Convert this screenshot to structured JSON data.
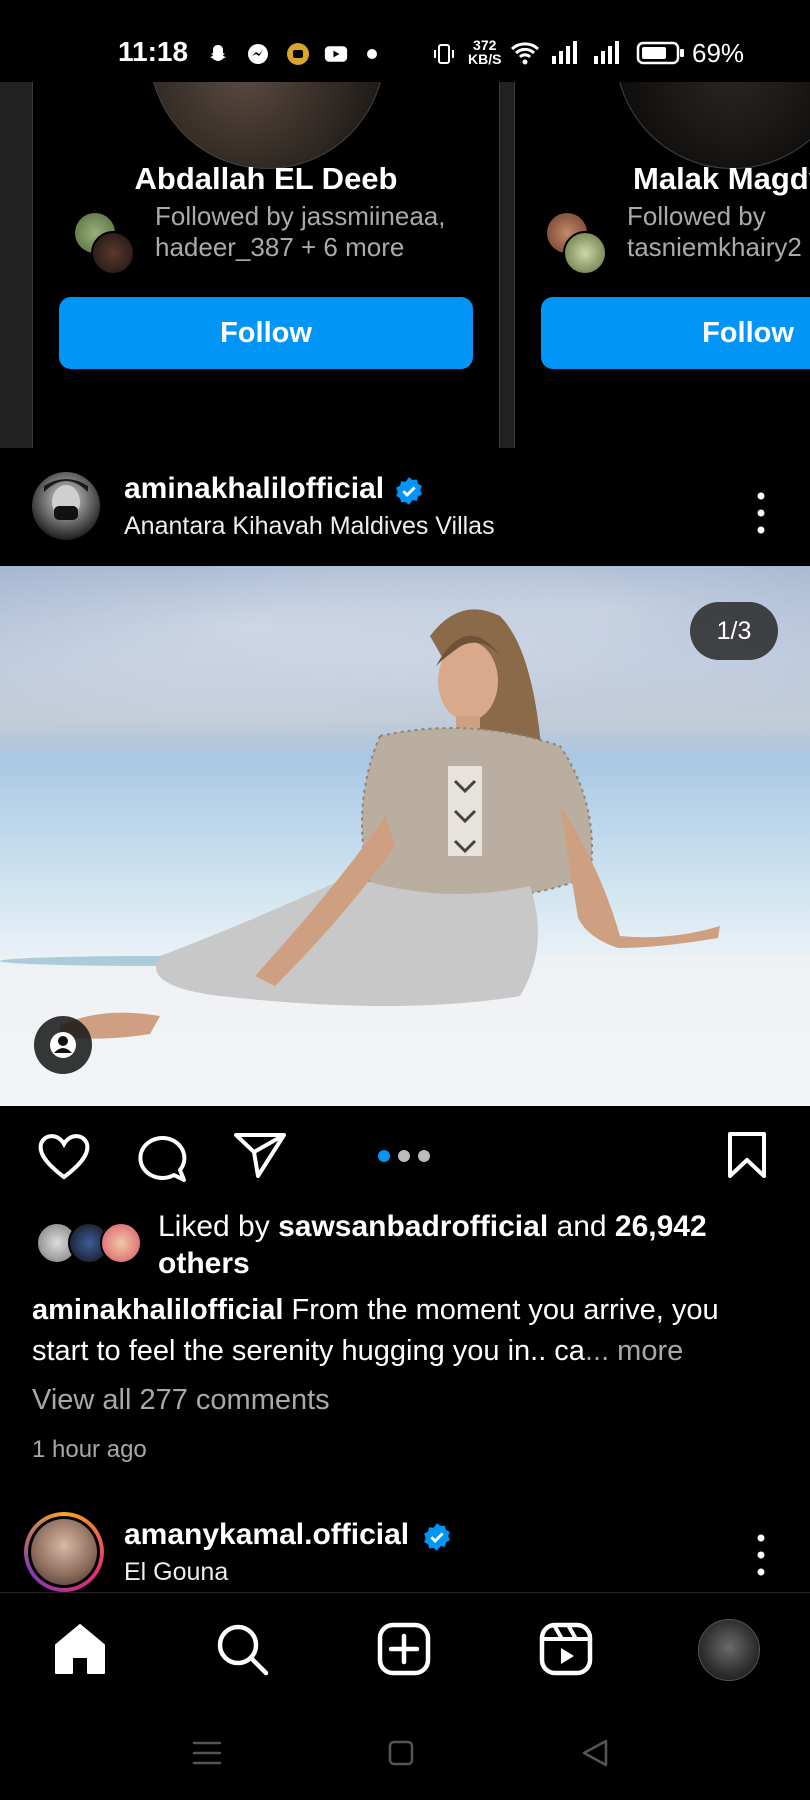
{
  "status_bar": {
    "time": "11:18",
    "net_speed_value": "372",
    "net_speed_unit": "KB/S",
    "battery": "69%"
  },
  "suggestions": [
    {
      "name": "Abdallah EL Deeb",
      "followed_line1": "Followed by jassmiineaa,",
      "followed_line2": "hadeer_387 + 6 more",
      "button": "Follow"
    },
    {
      "name": "Malak Magdy",
      "followed_line1": "Followed by",
      "followed_line2": "tasniemkhairy2",
      "button": "Follow"
    }
  ],
  "post": {
    "username": "aminakhalilofficial",
    "location": "Anantara Kihavah Maldives Villas",
    "verified": true,
    "counter": "1/3",
    "liked_by_prefix": "Liked by ",
    "liked_by_user": "sawsanbadrofficial",
    "liked_by_and": " and ",
    "liked_by_count": "26,942",
    "liked_by_others": "others",
    "caption_user": "aminakhalilofficial",
    "caption_text": " From the moment you arrive, you start to feel the serenity hugging you in.. ca",
    "caption_more": "... more",
    "view_comments": "View all 277 comments",
    "timestamp": "1 hour ago",
    "carousel_active_index": 0,
    "carousel_total": 3
  },
  "next_post": {
    "username": "amanykamal.official",
    "location": "El Gouna",
    "verified": true
  },
  "bottom_nav": [
    "home-icon",
    "search-icon",
    "create-icon",
    "reels-icon",
    "profile-avatar"
  ],
  "colors": {
    "accent": "#0095f6",
    "background": "#000000",
    "secondary_text": "#a8a8a8"
  }
}
